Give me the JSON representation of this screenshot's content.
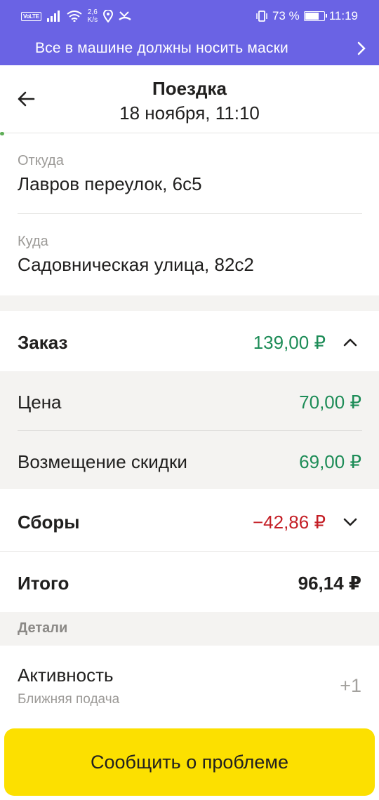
{
  "status_bar": {
    "volte": "VoLTE",
    "speed_value": "2,6",
    "speed_unit": "K/s",
    "battery_percent": "73 %",
    "battery_level": 0.73,
    "time": "11:19"
  },
  "banner": {
    "text": "Все в машине должны носить маски"
  },
  "header": {
    "title": "Поездка",
    "subtitle": "18 ноября, 11:10"
  },
  "route": {
    "from_label": "Откуда",
    "from_value": "Лавров переулок, 6с5",
    "to_label": "Куда",
    "to_value": "Садовническая улица, 82с2"
  },
  "order": {
    "label": "Заказ",
    "value": "139,00 ₽",
    "items": [
      {
        "label": "Цена",
        "value": "70,00 ₽"
      },
      {
        "label": "Возмещение скидки",
        "value": "69,00 ₽"
      }
    ]
  },
  "fees": {
    "label": "Сборы",
    "value": "−42,86 ₽"
  },
  "total": {
    "label": "Итого",
    "value": "96,14 ₽"
  },
  "details": {
    "section_label": "Детали",
    "activity_title": "Активность",
    "activity_subtitle": "Ближняя подача",
    "activity_value": "+1"
  },
  "actions": {
    "report_label": "Сообщить о проблеме"
  },
  "colors": {
    "accent": "#6a63e4",
    "positive": "#1d8c57",
    "negative": "#c41f26",
    "button": "#fce000"
  }
}
